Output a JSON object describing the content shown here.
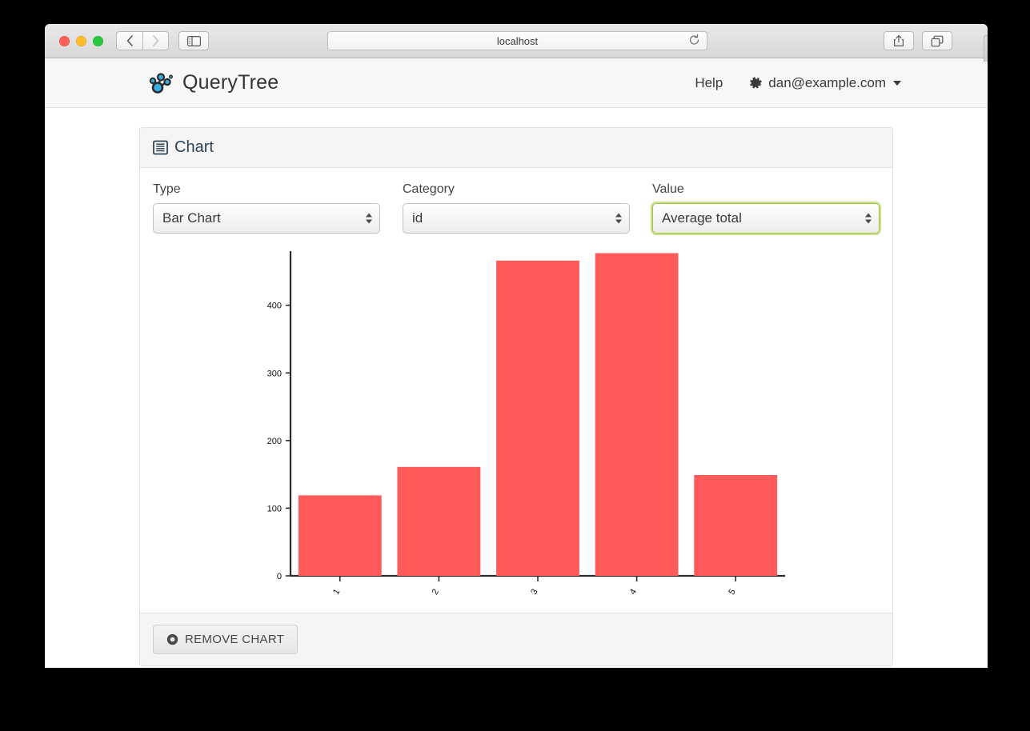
{
  "browser": {
    "url": "localhost",
    "reload_icon": "reload-icon",
    "back_icon": "chevron-left-icon",
    "forward_icon": "chevron-right-icon",
    "sidebar_icon": "sidebar-icon",
    "share_icon": "share-icon",
    "tabs_icon": "show-tabs-icon",
    "newtab_label": "+"
  },
  "app": {
    "brand": "QueryTree",
    "logo_icon": "querytree-node-graph-logo",
    "help_label": "Help",
    "account_email": "dan@example.com",
    "gear_icon": "gear-icon",
    "caret_icon": "chevron-down-icon"
  },
  "panel": {
    "title": "Chart",
    "title_icon": "table-list-icon",
    "remove_label": "REMOVE CHART",
    "remove_icon": "remove-circle-icon"
  },
  "controls": [
    {
      "label": "Type",
      "value": "Bar Chart",
      "name": "chart-type-select",
      "focused": false
    },
    {
      "label": "Category",
      "value": "id",
      "name": "chart-category-select",
      "focused": false
    },
    {
      "label": "Value",
      "value": "Average total",
      "name": "chart-value-select",
      "focused": true
    }
  ],
  "chart_data": {
    "type": "bar",
    "title": "",
    "xlabel": "",
    "ylabel": "",
    "categories": [
      "1",
      "2",
      "3",
      "4",
      "5"
    ],
    "values": [
      119,
      161,
      466,
      477,
      149
    ],
    "ylim": [
      0,
      480
    ],
    "yticks": [
      0,
      100,
      200,
      300,
      400
    ],
    "grid": false,
    "legend": false,
    "bar_color": "#ff5a5a",
    "axis_color": "#2b2b2b",
    "xtick_rotation": -60
  }
}
